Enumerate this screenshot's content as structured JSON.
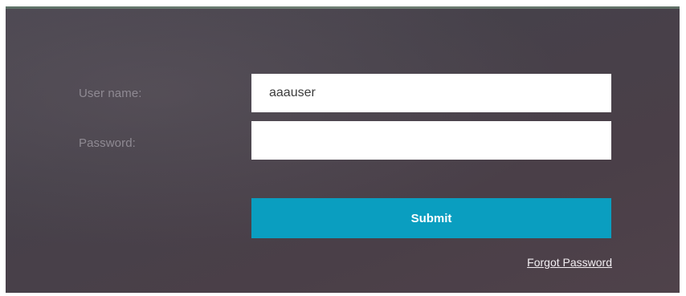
{
  "login_form": {
    "username_label": "User name:",
    "username_value": "aaauser",
    "password_label": "Password:",
    "password_value": "",
    "submit_label": "Submit",
    "forgot_password_label": "Forgot Password"
  },
  "colors": {
    "panel_background": "#47424b",
    "submit_button": "#0a9ec0",
    "label_text": "#8f8a93",
    "top_accent": "#6b7b70"
  }
}
